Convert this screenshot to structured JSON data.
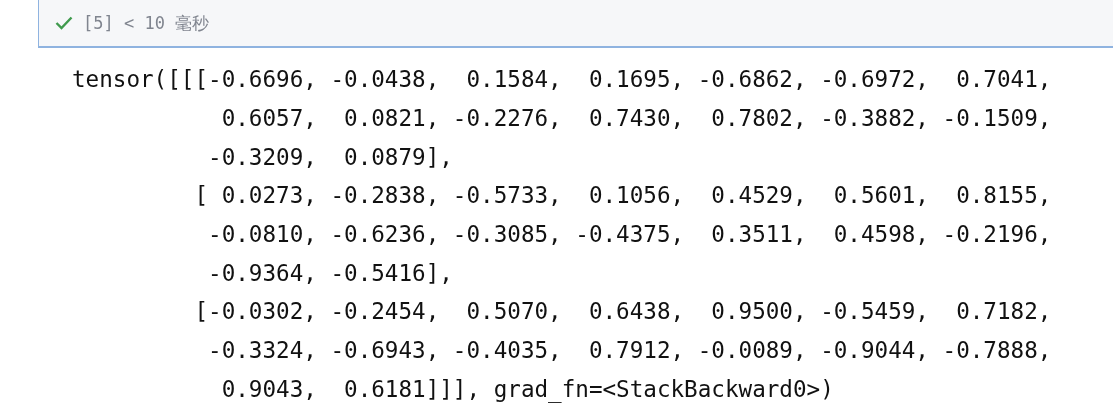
{
  "cell_status": {
    "succeeded": true,
    "text": "[5] < 10 毫秒"
  },
  "output_lines": [
    "tensor([[[-0.6696, -0.0438,  0.1584,  0.1695, -0.6862, -0.6972,  0.7041,",
    "           0.6057,  0.0821, -0.2276,  0.7430,  0.7802, -0.3882, -0.1509,",
    "          -0.3209,  0.0879],",
    "         [ 0.0273, -0.2838, -0.5733,  0.1056,  0.4529,  0.5601,  0.8155,",
    "          -0.0810, -0.6236, -0.3085, -0.4375,  0.3511,  0.4598, -0.2196,",
    "          -0.9364, -0.5416],",
    "         [-0.0302, -0.2454,  0.5070,  0.6438,  0.9500, -0.5459,  0.7182,",
    "          -0.3324, -0.6943, -0.4035,  0.7912, -0.0089, -0.9044, -0.7888,",
    "           0.9043,  0.6181]]], grad_fn=<StackBackward0>)"
  ]
}
